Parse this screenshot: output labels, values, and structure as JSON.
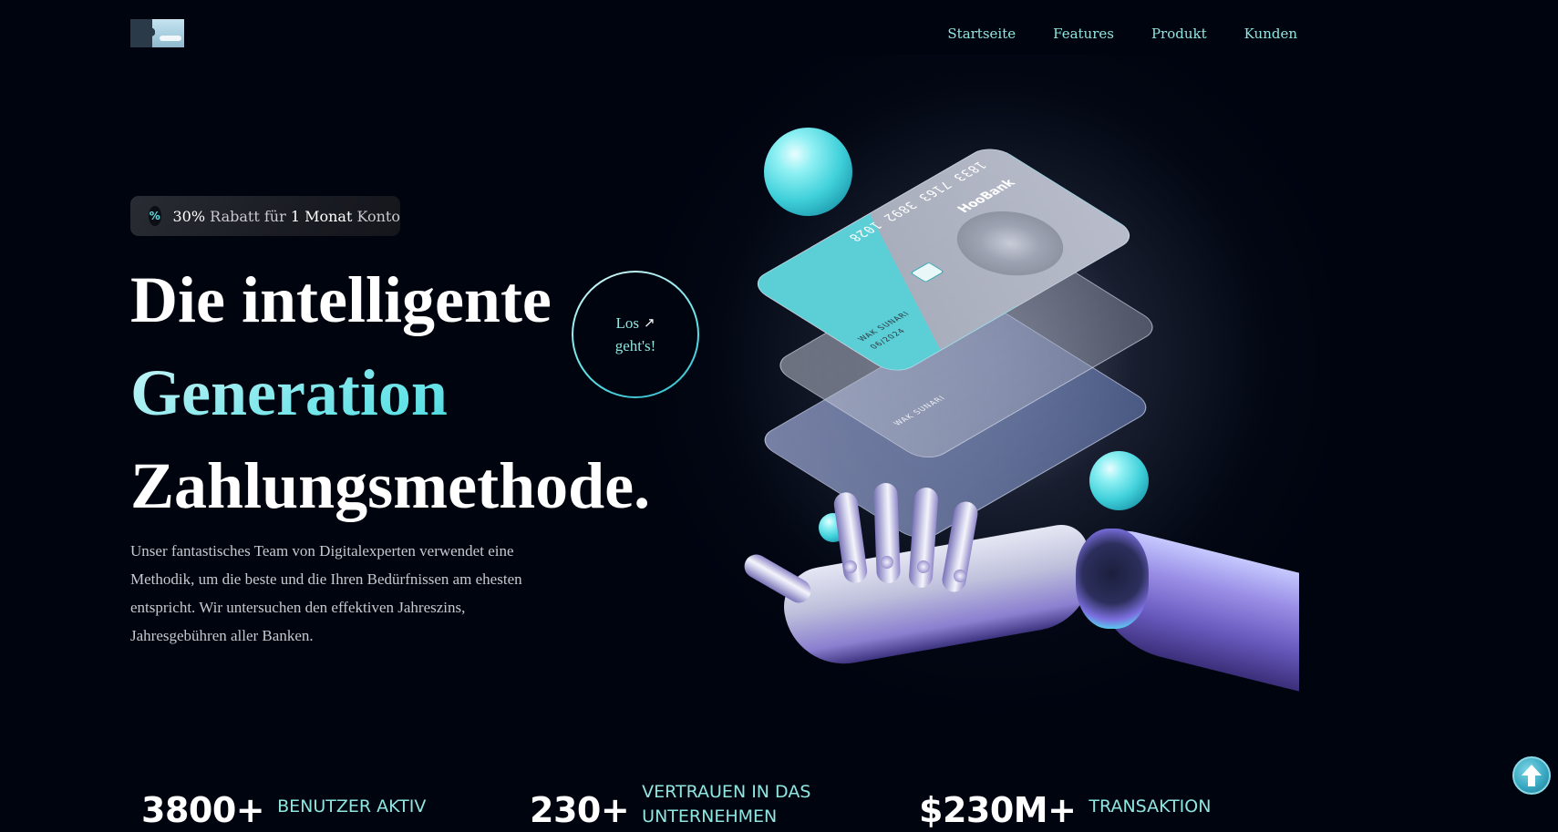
{
  "nav": {
    "links": [
      {
        "label": "Startseite"
      },
      {
        "label": "Features"
      },
      {
        "label": "Produkt"
      },
      {
        "label": "Kunden"
      }
    ]
  },
  "badge": {
    "discount": "30%",
    "text_1": "Rabatt für",
    "duration": "1 Monat",
    "text_2": "Konto",
    "icon": "percent-icon"
  },
  "hero": {
    "line_1": "Die intelligente",
    "line_2": "Generation",
    "line_3": "Zahlungsmethode.",
    "paragraph": "Unser fantastisches Team von Digitalexperten verwendet eine Methodik, um die beste und die Ihren Bedürfnissen am ehesten entspricht. Wir untersuchen den effektiven Jahreszins, Jahresgebühren aller Banken.",
    "cta_line_1": "Los",
    "cta_line_2": "geht's!",
    "cta_icon": "arrow-up-right-icon"
  },
  "cards": {
    "brand": "HooBank",
    "number": "1833 7163 3892 1028",
    "holder": "WAK SUNARI",
    "expiry": "06/2024"
  },
  "stats": [
    {
      "value": "3800+",
      "label": "BENUTZER AKTIV"
    },
    {
      "value": "230+",
      "label_line_1": "VERTRAUEN IN DAS",
      "label_line_2": "UNTERNEHMEN"
    },
    {
      "value": "$230M+",
      "label": "TRANSAKTION"
    }
  ],
  "scroll_top": {
    "icon": "arrow-up-icon"
  },
  "colors": {
    "background": "#00040f",
    "accent": "#5ce1e6",
    "nav_text": "#8fe6e0"
  }
}
